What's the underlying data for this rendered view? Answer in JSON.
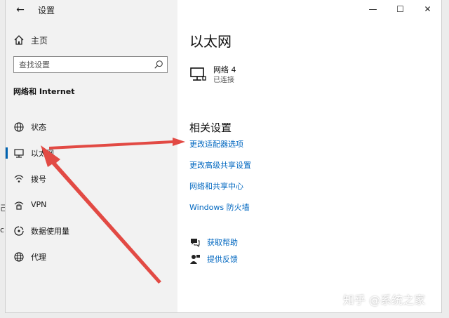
{
  "window": {
    "title": "设置",
    "controls": {
      "minimize": "—",
      "maximize": "☐",
      "close": "✕"
    }
  },
  "edge_glyphs": [
    "己",
    "c"
  ],
  "sidebar": {
    "home_label": "主页",
    "search": {
      "placeholder": "查找设置",
      "value": ""
    },
    "section_title": "网络和 Internet",
    "items": [
      {
        "label": "状态",
        "icon": "status-globe-icon",
        "selected": false
      },
      {
        "label": "以太网",
        "icon": "ethernet-monitor-icon",
        "selected": true
      },
      {
        "label": "拨号",
        "icon": "dialup-icon",
        "selected": false
      },
      {
        "label": "VPN",
        "icon": "vpn-icon",
        "selected": false
      },
      {
        "label": "数据使用量",
        "icon": "data-usage-icon",
        "selected": false
      },
      {
        "label": "代理",
        "icon": "proxy-globe-icon",
        "selected": false
      }
    ]
  },
  "main": {
    "title": "以太网",
    "network": {
      "name": "网络 4",
      "status": "已连接",
      "icon": "ethernet-monitor-icon"
    },
    "related_title": "相关设置",
    "links": [
      "更改适配器选项",
      "更改高级共享设置",
      "网络和共享中心",
      "Windows 防火墙"
    ],
    "help": [
      {
        "label": "获取帮助",
        "icon": "help-chat-icon"
      },
      {
        "label": "提供反馈",
        "icon": "feedback-person-icon"
      }
    ]
  },
  "watermark": "知乎 @系统之家",
  "colors": {
    "accent": "#0063b1",
    "link": "#0067c0",
    "arrow": "#e24a44",
    "sidebar_bg": "#f2f2f2"
  }
}
